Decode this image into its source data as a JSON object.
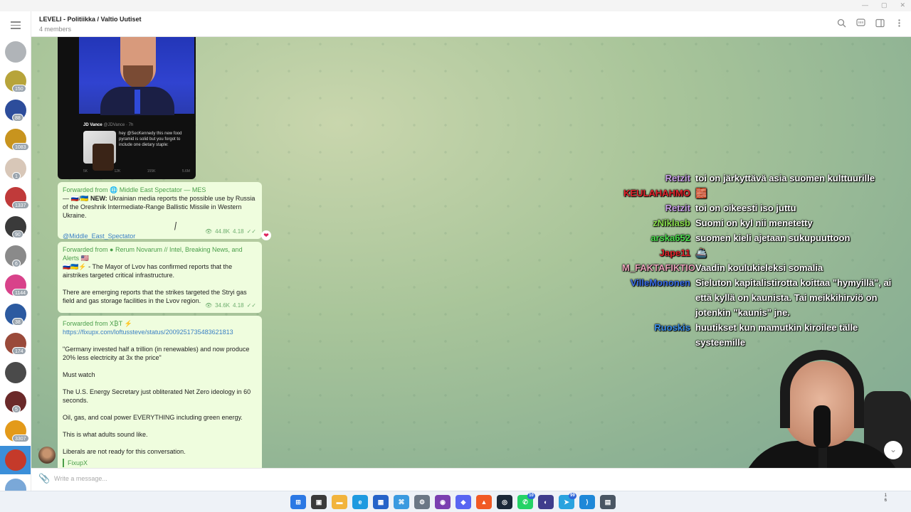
{
  "window": {
    "title": "LEVELI - Politiikka / Valtio Uutiset",
    "subtitle": "4 members",
    "controls": [
      "—",
      "▢",
      "✕"
    ]
  },
  "header_icons": [
    "search-icon",
    "comments-icon",
    "sidebar-icon",
    "more-icon"
  ],
  "sidebar": {
    "chats": [
      {
        "name": "archive",
        "badge": "",
        "color": "#b0b4b8"
      },
      {
        "name": "chat-1",
        "badge": "150",
        "color": "#b7a43a"
      },
      {
        "name": "chat-2",
        "badge": "88",
        "color": "#2d4d9b"
      },
      {
        "name": "chat-3",
        "badge": "1083",
        "color": "#c8941e"
      },
      {
        "name": "chat-4",
        "badge": "1",
        "color": "#d8c7b8"
      },
      {
        "name": "chat-5",
        "badge": "1337",
        "color": "#c03a3a"
      },
      {
        "name": "chat-6",
        "badge": "90",
        "color": "#3a3a3a"
      },
      {
        "name": "chat-7",
        "badge": "6",
        "color": "#8a8a8a"
      },
      {
        "name": "chat-8",
        "badge": "1144",
        "color": "#d8428a"
      },
      {
        "name": "chat-9",
        "badge": "38",
        "color": "#2c5aa0"
      },
      {
        "name": "chat-10",
        "badge": "174",
        "color": "#9a4a3a"
      },
      {
        "name": "chat-11",
        "badge": "",
        "color": "#4a4a4a"
      },
      {
        "name": "chat-12",
        "badge": "5",
        "color": "#6b2a2a"
      },
      {
        "name": "chat-13",
        "badge": "3307",
        "color": "#e39a1a"
      },
      {
        "name": "chat-14",
        "badge": "",
        "color": "#c53a2a"
      },
      {
        "name": "chat-15",
        "badge": "",
        "color": "#7aa8d8"
      }
    ]
  },
  "image_post": {
    "tweet_author": "JD Vance",
    "tweet_handle": "@JDVance · 7h",
    "tweet_text": "hey @SecKennedy this new food pyramid is solid but you forgot to include one dietary staple:",
    "tweet_stats": [
      "5K",
      "12K",
      "155K",
      "5.6M",
      "",
      ""
    ]
  },
  "messages": [
    {
      "forwarded_label": "Forwarded from",
      "source": "Middle East Spectator — MES",
      "flags": "— 🇷🇺/🇺🇦",
      "bold_prefix": "NEW:",
      "text": "Ukrainian media reports the possible use by Russia of the Oreshnik Intermediate-Range Ballistic Missile in Western Ukraine.",
      "link": "@Middle_East_Spectator",
      "views": "44.8K",
      "time": "4.18",
      "reaction": "❤"
    },
    {
      "forwarded_label": "Forwarded from",
      "source": "Rerum Novarum // Intel, Breaking News, and Alerts 🇺🇸",
      "flags": "🇷🇺🇺🇦⚡",
      "text": "- The Mayor of Lvov has confirmed reports that the airstrikes targeted critical infrastructure.",
      "text2": "There are emerging reports that the strikes targeted the Stryi gas field and gas storage facilities in the Lvov region.",
      "views": "34.6K",
      "time": "4.18"
    },
    {
      "forwarded_label": "Forwarded from",
      "source": "X₿T ⚡",
      "link": "https://fixupx.com/loftussteve/status/2009251735483621813",
      "paragraphs": [
        "\"Germany invested half a trillion (in renewables) and now produce 20% less electricity at 3x the price\"",
        "Must watch",
        "The U.S. Energy Secretary just obliterated Net Zero ideology in 60 seconds.",
        "Oil, gas, and coal power EVERYTHING including green energy.",
        "This is what adults sound like.",
        "Liberals are not ready for this conversation."
      ],
      "quote": "FixupX"
    }
  ],
  "stream_chat": [
    {
      "user": "Retzit",
      "color": "#c9a3e8",
      "msg": "toi on järkyttävä asia suomen kulttuurille"
    },
    {
      "user": "KEULAHAHMO",
      "color": "#e0242b",
      "msg": "🧱"
    },
    {
      "user": "Retzit",
      "color": "#c9a3e8",
      "msg": "toi on oikeesti iso juttu"
    },
    {
      "user": "zNiklasb",
      "color": "#8be04e",
      "msg": "Suomi on kyl nii menetetty"
    },
    {
      "user": "arska652",
      "color": "#4be04e",
      "msg": "suomen kieli ajetaan sukupuuttoon"
    },
    {
      "user": "Jape11",
      "color": "#e0242b",
      "msg": "🚢"
    },
    {
      "user": "M_FAKTAFIKTIO",
      "color": "#e8a3b8",
      "msg": "Vaadin koulukieleksi somalia"
    },
    {
      "user": "VilleMononen",
      "color": "#3a6ee8",
      "msg": "Sieluton kapitalistirotta koittaa \"hymyillä\", ai että kyllä on kaunista. Tai meikkihirviö on jotenkin \"kaunis\" jne."
    },
    {
      "user": "Ruoskis",
      "color": "#3a8ee8",
      "msg": "huutikset kun mamutkin kiroilee tälle systeemille"
    }
  ],
  "composer": {
    "placeholder": "Write a message..."
  },
  "taskbar": {
    "icons": [
      {
        "name": "windows-start-icon",
        "color": "#2b78e4",
        "glyph": "⊞",
        "badge": ""
      },
      {
        "name": "task-view-icon",
        "color": "#3a3a3a",
        "glyph": "▣",
        "badge": ""
      },
      {
        "name": "file-explorer-icon",
        "color": "#f2b43c",
        "glyph": "▬",
        "badge": ""
      },
      {
        "name": "edge-icon",
        "color": "#1e9ae0",
        "glyph": "e",
        "badge": ""
      },
      {
        "name": "store-icon",
        "color": "#2563c9",
        "glyph": "▦",
        "badge": ""
      },
      {
        "name": "app-icon",
        "color": "#3a9ae0",
        "glyph": "⌘",
        "badge": ""
      },
      {
        "name": "settings-icon",
        "color": "#6b7785",
        "glyph": "⚙",
        "badge": ""
      },
      {
        "name": "obs-icon",
        "color": "#7b3fb0",
        "glyph": "◉",
        "badge": ""
      },
      {
        "name": "discord-icon",
        "color": "#5865f2",
        "glyph": "◆",
        "badge": ""
      },
      {
        "name": "brave-icon",
        "color": "#f15a24",
        "glyph": "▲",
        "badge": ""
      },
      {
        "name": "steam-icon",
        "color": "#1b2838",
        "glyph": "◎",
        "badge": ""
      },
      {
        "name": "whatsapp-icon",
        "color": "#25d366",
        "glyph": "✆",
        "badge": "10"
      },
      {
        "name": "chat-app-icon",
        "color": "#3f3d8c",
        "glyph": "◐",
        "badge": ""
      },
      {
        "name": "telegram-icon",
        "color": "#2aa3df",
        "glyph": "➤",
        "badge": "99"
      },
      {
        "name": "vscode-icon",
        "color": "#1e88d8",
        "glyph": "⟩",
        "badge": ""
      },
      {
        "name": "calculator-icon",
        "color": "#4a5663",
        "glyph": "▤",
        "badge": ""
      }
    ],
    "tray_top": "1",
    "tray_bottom": "6"
  }
}
